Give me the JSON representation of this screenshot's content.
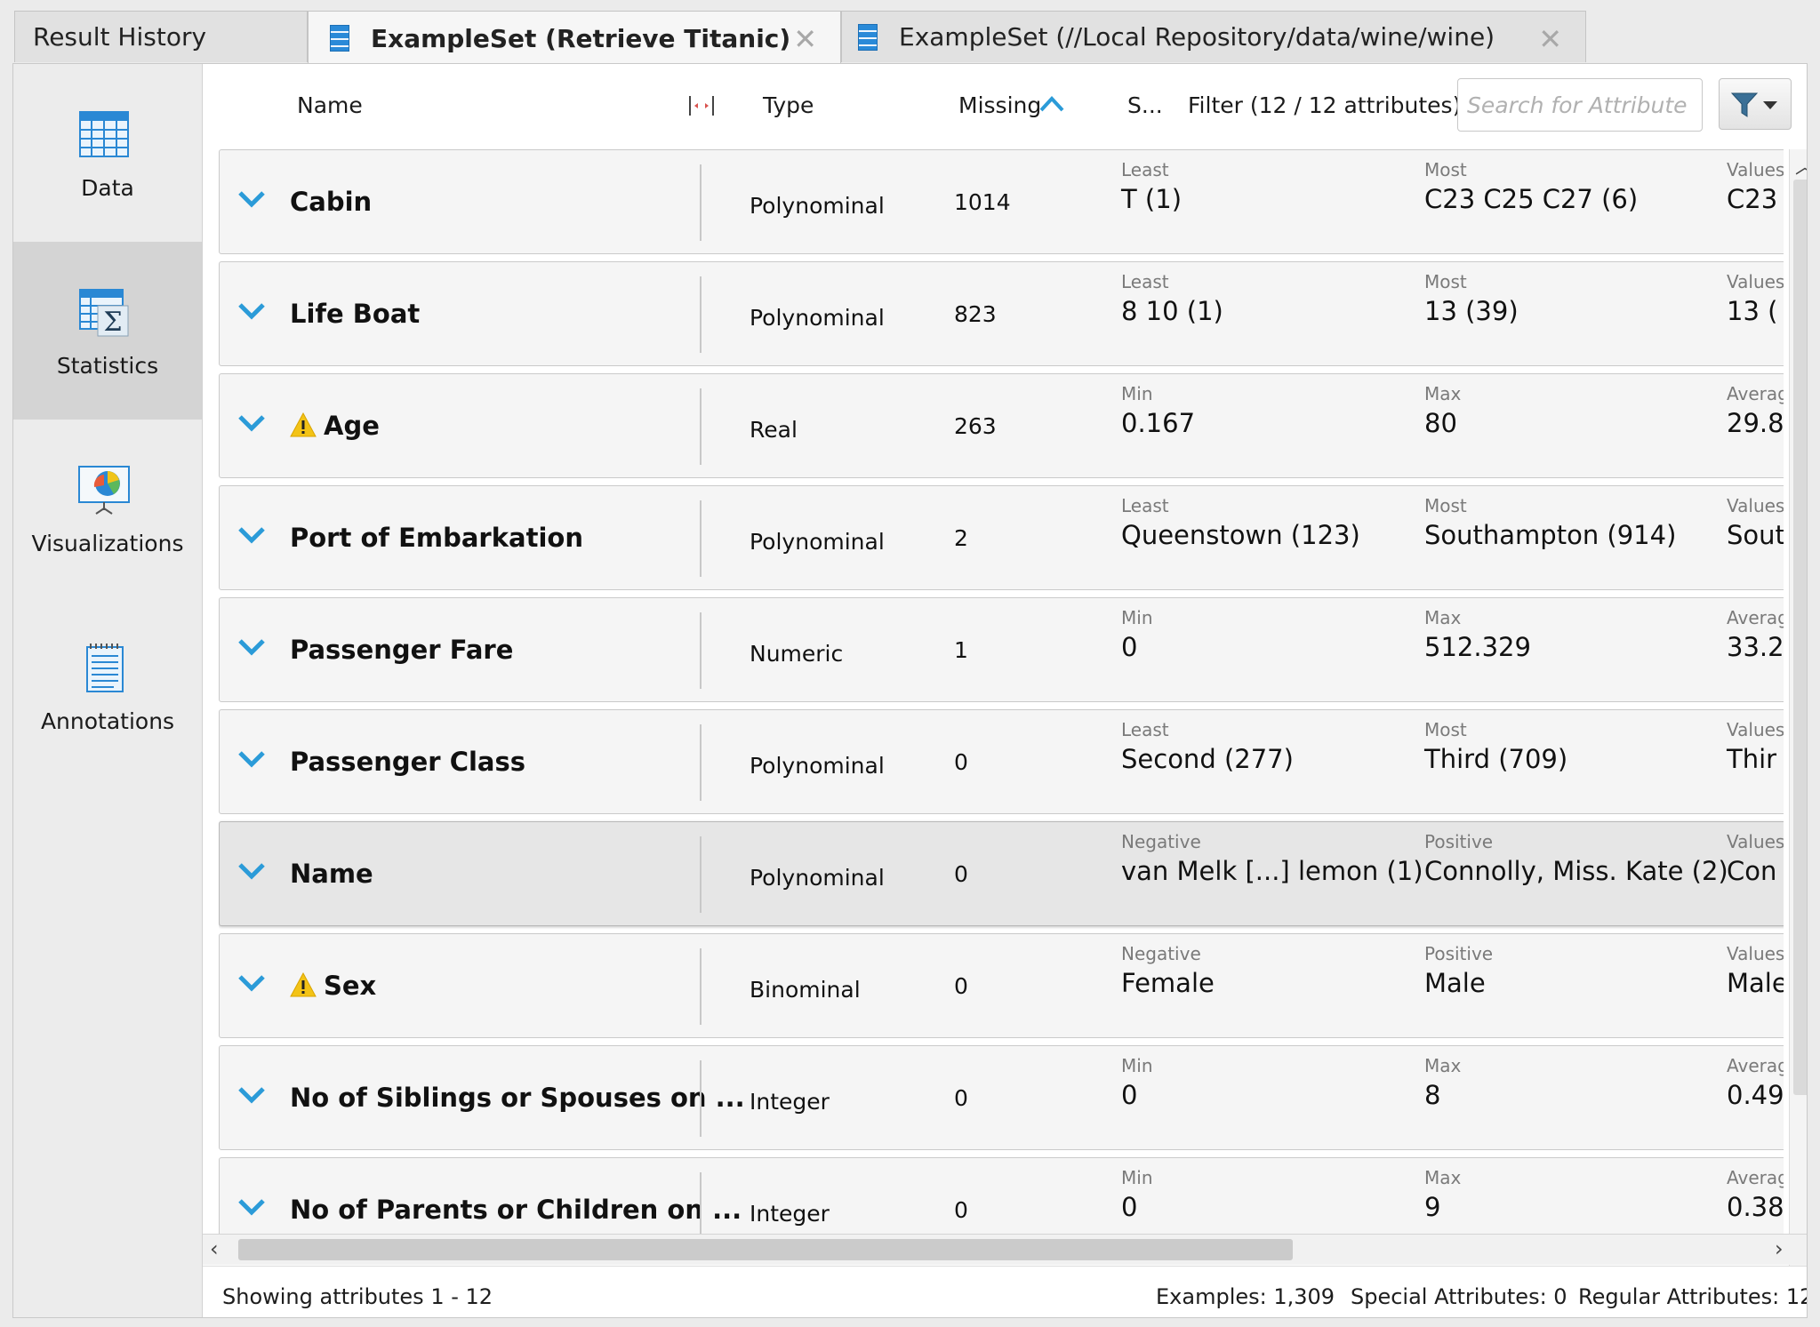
{
  "tabs": [
    {
      "label": "Result History",
      "active": false,
      "closable": false
    },
    {
      "label": "ExampleSet (Retrieve Titanic)",
      "active": true,
      "closable": true
    },
    {
      "label": "ExampleSet (//Local Repository/data/wine/wine)",
      "active": false,
      "closable": true
    }
  ],
  "tab_close_glyph": "✕",
  "sidebar": {
    "items": [
      {
        "label": "Data",
        "icon": "data-table-icon",
        "active": false
      },
      {
        "label": "Statistics",
        "icon": "statistics-icon",
        "active": true
      },
      {
        "label": "Visualizations",
        "icon": "visualizations-icon",
        "active": false
      },
      {
        "label": "Annotations",
        "icon": "annotations-icon",
        "active": false
      }
    ]
  },
  "header": {
    "name": "Name",
    "type": "Type",
    "missing": "Missing",
    "stats": "S...",
    "filter": "Filter (12 / 12 attributes):",
    "search_placeholder": "Search for Attribute",
    "sort_indicator": "ascending"
  },
  "rows": [
    {
      "name": "Cabin",
      "warning": false,
      "type": "Polynominal",
      "missing": "1014",
      "stats": [
        {
          "label": "Least",
          "value": "T (1)"
        },
        {
          "label": "Most",
          "value": "C23 C25 C27 (6)"
        },
        {
          "label": "Values",
          "value": "C23"
        }
      ]
    },
    {
      "name": "Life Boat",
      "warning": false,
      "type": "Polynominal",
      "missing": "823",
      "stats": [
        {
          "label": "Least",
          "value": "8 10 (1)"
        },
        {
          "label": "Most",
          "value": "13 (39)"
        },
        {
          "label": "Values",
          "value": "13 ("
        }
      ]
    },
    {
      "name": "Age",
      "warning": true,
      "type": "Real",
      "missing": "263",
      "stats": [
        {
          "label": "Min",
          "value": "0.167"
        },
        {
          "label": "Max",
          "value": "80"
        },
        {
          "label": "Average",
          "value": "29.8"
        }
      ]
    },
    {
      "name": "Port of Embarkation",
      "warning": false,
      "type": "Polynominal",
      "missing": "2",
      "stats": [
        {
          "label": "Least",
          "value": "Queenstown (123)"
        },
        {
          "label": "Most",
          "value": "Southampton (914)"
        },
        {
          "label": "Values",
          "value": "Sout"
        }
      ]
    },
    {
      "name": "Passenger Fare",
      "warning": false,
      "type": "Numeric",
      "missing": "1",
      "stats": [
        {
          "label": "Min",
          "value": "0"
        },
        {
          "label": "Max",
          "value": "512.329"
        },
        {
          "label": "Average",
          "value": "33.2"
        }
      ]
    },
    {
      "name": "Passenger Class",
      "warning": false,
      "type": "Polynominal",
      "missing": "0",
      "stats": [
        {
          "label": "Least",
          "value": "Second (277)"
        },
        {
          "label": "Most",
          "value": "Third (709)"
        },
        {
          "label": "Values",
          "value": "Thir"
        }
      ]
    },
    {
      "name": "Name",
      "warning": false,
      "type": "Polynominal",
      "missing": "0",
      "selected": true,
      "stats": [
        {
          "label": "Negative",
          "value": "van Melk [...] lemon (1)"
        },
        {
          "label": "Positive",
          "value": "Connolly, Miss. Kate (2)"
        },
        {
          "label": "Values",
          "value": "Con"
        }
      ]
    },
    {
      "name": "Sex",
      "warning": true,
      "type": "Binominal",
      "missing": "0",
      "stats": [
        {
          "label": "Negative",
          "value": "Female"
        },
        {
          "label": "Positive",
          "value": "Male"
        },
        {
          "label": "Values",
          "value": "Male"
        }
      ]
    },
    {
      "name": "No of Siblings or Spouses on ...",
      "warning": false,
      "type": "Integer",
      "missing": "0",
      "stats": [
        {
          "label": "Min",
          "value": "0"
        },
        {
          "label": "Max",
          "value": "8"
        },
        {
          "label": "Average",
          "value": "0.49"
        }
      ]
    },
    {
      "name": "No of Parents or Children on ...",
      "warning": false,
      "type": "Integer",
      "missing": "0",
      "stats": [
        {
          "label": "Min",
          "value": "0"
        },
        {
          "label": "Max",
          "value": "9"
        },
        {
          "label": "Average",
          "value": "0.38"
        }
      ]
    }
  ],
  "status": {
    "showing": "Showing attributes 1 - 12",
    "examples": "Examples: 1,309",
    "special": "Special Attributes: 0",
    "regular": "Regular Attributes: 12"
  },
  "colors": {
    "accent": "#2b9bd8",
    "warning": "#f3c316",
    "selected_row": "#e6e6e6"
  }
}
